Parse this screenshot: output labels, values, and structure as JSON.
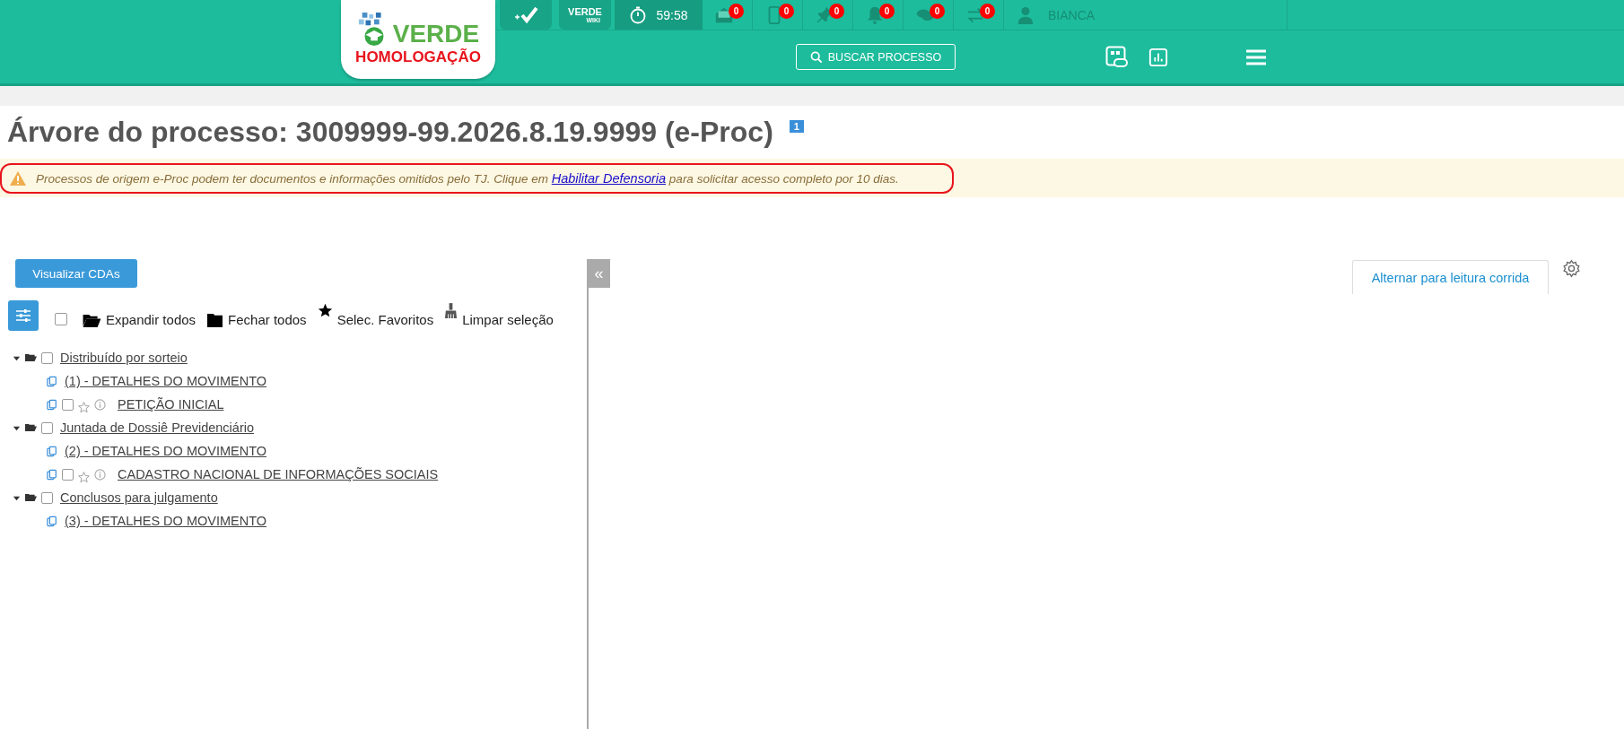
{
  "header": {
    "logo": {
      "name": "VERDE",
      "environment": "HOMOLOGAÇÃO"
    },
    "wiki": {
      "title": "VERDE",
      "subtitle": "WIKI"
    },
    "timer": "59:58",
    "notifications": [
      {
        "kind": "inbox",
        "count": "0"
      },
      {
        "kind": "phone",
        "count": "0"
      },
      {
        "kind": "pin",
        "count": "0"
      },
      {
        "kind": "bell",
        "count": "0"
      },
      {
        "kind": "chat",
        "count": "0"
      },
      {
        "kind": "transfer",
        "count": "0"
      }
    ],
    "user": "BIANCA",
    "search_button": "BUSCAR PROCESSO"
  },
  "page": {
    "title": "Árvore do processo: 3009999-99.2026.8.19.9999 (e-Proc)",
    "badge": "1"
  },
  "alert": {
    "before": "Processos de origem e-Proc podem ter documentos e informações omitidos pelo TJ. Clique em",
    "link": "Habilitar Defensoria",
    "after": "para solicitar acesso completo por 10 dias."
  },
  "left_panel": {
    "button": "Visualizar CDAs",
    "toolbar": {
      "select_all_checked": false,
      "actions": [
        {
          "kind": "expand",
          "label": "Expandir todos"
        },
        {
          "kind": "collapse",
          "label": "Fechar todos"
        },
        {
          "kind": "favorites",
          "label": "Selec. Favoritos"
        },
        {
          "kind": "clear",
          "label": "Limpar seleção"
        }
      ]
    },
    "tree": [
      {
        "kind": "group",
        "label": "Distribuído por sorteio",
        "expanded": true,
        "checked": false,
        "children": [
          {
            "kind": "movement",
            "label": "(1) - DETALHES DO MOVIMENTO"
          },
          {
            "kind": "document",
            "label": "PETIÇÃO INICIAL",
            "checked": false,
            "favorite": false
          }
        ]
      },
      {
        "kind": "group",
        "label": "Juntada de Dossiê Previdenciário",
        "expanded": true,
        "checked": false,
        "children": [
          {
            "kind": "movement",
            "label": "(2) - DETALHES DO MOVIMENTO"
          },
          {
            "kind": "document",
            "label": "CADASTRO NACIONAL DE INFORMAÇÕES SOCIAIS",
            "checked": false,
            "favorite": false
          }
        ]
      },
      {
        "kind": "group",
        "label": "Conclusos para julgamento",
        "expanded": true,
        "checked": false,
        "children": [
          {
            "kind": "movement",
            "label": "(3) - DETALHES DO MOVIMENTO"
          }
        ]
      }
    ]
  },
  "right_panel": {
    "collapse_button": "«",
    "tab": "Alternar para leitura corrida"
  }
}
